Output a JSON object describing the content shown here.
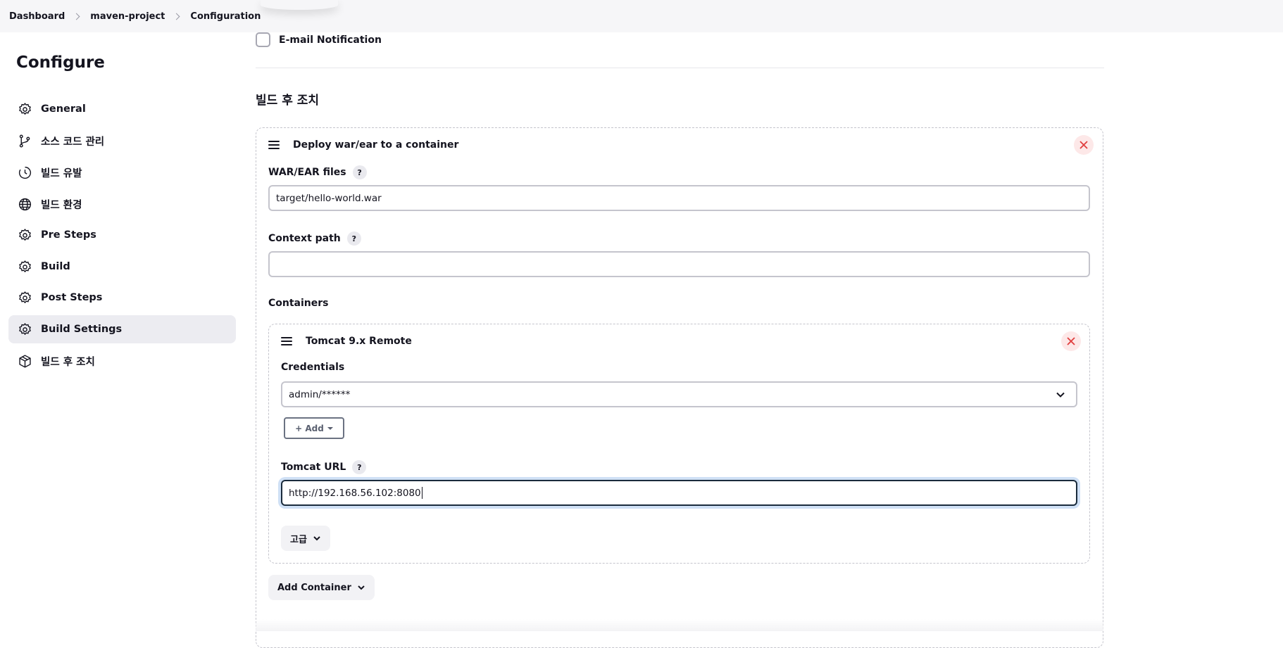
{
  "breadcrumb": {
    "items": [
      "Dashboard",
      "maven-project",
      "Configuration"
    ]
  },
  "sidebar": {
    "title": "Configure",
    "items": [
      {
        "label": "General",
        "icon": "gear-icon"
      },
      {
        "label": "소스 코드 관리",
        "icon": "git-branch-icon"
      },
      {
        "label": "빌드 유발",
        "icon": "clock-icon"
      },
      {
        "label": "빌드 환경",
        "icon": "globe-icon"
      },
      {
        "label": "Pre Steps",
        "icon": "gear-icon"
      },
      {
        "label": "Build",
        "icon": "gear-icon"
      },
      {
        "label": "Post Steps",
        "icon": "gear-icon"
      },
      {
        "label": "Build Settings",
        "icon": "gear-icon",
        "active": true
      },
      {
        "label": "빌드 후 조치",
        "icon": "package-icon"
      }
    ]
  },
  "main": {
    "email_notification": {
      "label": "E-mail Notification",
      "checked": false
    },
    "section_title": "빌드 후 조치",
    "deploy": {
      "title": "Deploy war/ear to a container",
      "war_files": {
        "label": "WAR/EAR files",
        "help": "?",
        "value": "target/hello-world.war"
      },
      "context_path": {
        "label": "Context path",
        "help": "?",
        "value": ""
      },
      "containers_label": "Containers",
      "container": {
        "title": "Tomcat 9.x Remote",
        "credentials": {
          "label": "Credentials",
          "value": "admin/******"
        },
        "add_button": "+ Add",
        "tomcat_url": {
          "label": "Tomcat URL",
          "help": "?",
          "value": "http://192.168.56.102:8080"
        },
        "advanced_button": "고급"
      },
      "add_container_button": "Add Container"
    }
  },
  "colors": {
    "accent_focus": "#cfe0f5",
    "close_bg": "#fde8e8",
    "close_fg": "#e03e3e",
    "active_bg": "#ececf1"
  }
}
